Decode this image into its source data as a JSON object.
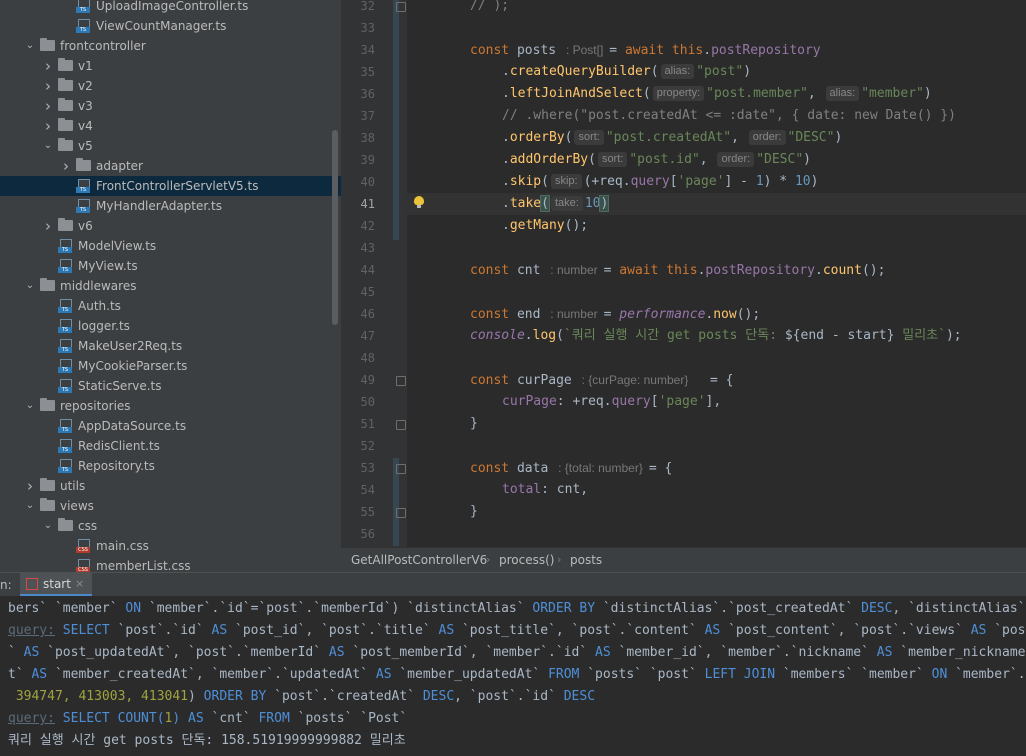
{
  "project_tree": {
    "items": [
      {
        "label": "UploadImageController.ts",
        "type": "ts",
        "indent": 5,
        "arrow": "",
        "selected": false
      },
      {
        "label": "ViewCountManager.ts",
        "type": "ts",
        "indent": 5,
        "arrow": "",
        "selected": false
      },
      {
        "label": "frontcontroller",
        "type": "folder",
        "indent": 3,
        "arrow": "open",
        "selected": false
      },
      {
        "label": "v1",
        "type": "folder",
        "indent": 4,
        "arrow": "closed",
        "selected": false
      },
      {
        "label": "v2",
        "type": "folder",
        "indent": 4,
        "arrow": "closed",
        "selected": false
      },
      {
        "label": "v3",
        "type": "folder",
        "indent": 4,
        "arrow": "closed",
        "selected": false
      },
      {
        "label": "v4",
        "type": "folder",
        "indent": 4,
        "arrow": "closed",
        "selected": false
      },
      {
        "label": "v5",
        "type": "folder",
        "indent": 4,
        "arrow": "open",
        "selected": false
      },
      {
        "label": "adapter",
        "type": "folder",
        "indent": 5,
        "arrow": "closed",
        "selected": false
      },
      {
        "label": "FrontControllerServletV5.ts",
        "type": "ts",
        "indent": 5,
        "arrow": "",
        "selected": true
      },
      {
        "label": "MyHandlerAdapter.ts",
        "type": "ts",
        "indent": 5,
        "arrow": "",
        "selected": false
      },
      {
        "label": "v6",
        "type": "folder",
        "indent": 4,
        "arrow": "closed",
        "selected": false
      },
      {
        "label": "ModelView.ts",
        "type": "ts",
        "indent": 4,
        "arrow": "",
        "selected": false
      },
      {
        "label": "MyView.ts",
        "type": "ts",
        "indent": 4,
        "arrow": "",
        "selected": false
      },
      {
        "label": "middlewares",
        "type": "folder",
        "indent": 3,
        "arrow": "open",
        "selected": false
      },
      {
        "label": "Auth.ts",
        "type": "ts",
        "indent": 4,
        "arrow": "",
        "selected": false
      },
      {
        "label": "logger.ts",
        "type": "ts",
        "indent": 4,
        "arrow": "",
        "selected": false
      },
      {
        "label": "MakeUser2Req.ts",
        "type": "ts",
        "indent": 4,
        "arrow": "",
        "selected": false
      },
      {
        "label": "MyCookieParser.ts",
        "type": "ts",
        "indent": 4,
        "arrow": "",
        "selected": false
      },
      {
        "label": "StaticServe.ts",
        "type": "ts",
        "indent": 4,
        "arrow": "",
        "selected": false
      },
      {
        "label": "repositories",
        "type": "folder",
        "indent": 3,
        "arrow": "open",
        "selected": false
      },
      {
        "label": "AppDataSource.ts",
        "type": "ts",
        "indent": 4,
        "arrow": "",
        "selected": false
      },
      {
        "label": "RedisClient.ts",
        "type": "ts",
        "indent": 4,
        "arrow": "",
        "selected": false
      },
      {
        "label": "Repository.ts",
        "type": "ts",
        "indent": 4,
        "arrow": "",
        "selected": false
      },
      {
        "label": "utils",
        "type": "folder",
        "indent": 3,
        "arrow": "closed",
        "selected": false
      },
      {
        "label": "views",
        "type": "folder",
        "indent": 3,
        "arrow": "open",
        "selected": false
      },
      {
        "label": "css",
        "type": "folder",
        "indent": 4,
        "arrow": "open",
        "selected": false
      },
      {
        "label": "main.css",
        "type": "css",
        "indent": 5,
        "arrow": "",
        "selected": false
      },
      {
        "label": "memberList.css",
        "type": "css",
        "indent": 5,
        "arrow": "",
        "selected": false
      }
    ]
  },
  "editor": {
    "line_numbers": [
      "32",
      "33",
      "34",
      "35",
      "36",
      "37",
      "38",
      "39",
      "40",
      "41",
      "42",
      "43",
      "44",
      "45",
      "46",
      "47",
      "48",
      "49",
      "50",
      "51",
      "52",
      "53",
      "54",
      "55",
      "56"
    ],
    "current_line": "41",
    "lines": [
      {
        "indent": 0,
        "tokens": [
          {
            "c": "cmt",
            "t": "// );"
          }
        ]
      },
      {
        "indent": 0,
        "tokens": []
      },
      {
        "indent": 0,
        "tokens": [
          {
            "c": "kw",
            "t": "const "
          },
          {
            "c": "",
            "t": "posts "
          },
          {
            "c": "hint2",
            "t": ": Post[]"
          },
          {
            "c": "",
            "t": "= "
          },
          {
            "c": "kw",
            "t": "await this"
          },
          {
            "c": "",
            "t": "."
          },
          {
            "c": "prop",
            "t": "postRepository"
          }
        ]
      },
      {
        "indent": 1,
        "tokens": [
          {
            "c": "",
            "t": "."
          },
          {
            "c": "fn",
            "t": "createQueryBuilder"
          },
          {
            "c": "",
            "t": "("
          },
          {
            "c": "hint",
            "t": "alias:"
          },
          {
            "c": "str",
            "t": "\"post\""
          },
          {
            "c": "",
            "t": ")"
          }
        ]
      },
      {
        "indent": 1,
        "tokens": [
          {
            "c": "",
            "t": "."
          },
          {
            "c": "fn",
            "t": "leftJoinAndSelect"
          },
          {
            "c": "",
            "t": "("
          },
          {
            "c": "hint",
            "t": "property:"
          },
          {
            "c": "str",
            "t": "\"post.member\""
          },
          {
            "c": "",
            "t": ", "
          },
          {
            "c": "hint",
            "t": "alias:"
          },
          {
            "c": "str",
            "t": "\"member\""
          },
          {
            "c": "",
            "t": ")"
          }
        ]
      },
      {
        "indent": 1,
        "tokens": [
          {
            "c": "cmt",
            "t": "// .where(\"post.createdAt <= :date\", { date: new Date() })"
          }
        ]
      },
      {
        "indent": 1,
        "tokens": [
          {
            "c": "",
            "t": "."
          },
          {
            "c": "fn",
            "t": "orderBy"
          },
          {
            "c": "",
            "t": "("
          },
          {
            "c": "hint",
            "t": "sort:"
          },
          {
            "c": "str",
            "t": "\"post.createdAt\""
          },
          {
            "c": "",
            "t": ", "
          },
          {
            "c": "hint",
            "t": "order:"
          },
          {
            "c": "str",
            "t": "\"DESC\""
          },
          {
            "c": "",
            "t": ")"
          }
        ]
      },
      {
        "indent": 1,
        "tokens": [
          {
            "c": "",
            "t": "."
          },
          {
            "c": "fn",
            "t": "addOrderBy"
          },
          {
            "c": "",
            "t": "("
          },
          {
            "c": "hint",
            "t": "sort:"
          },
          {
            "c": "str",
            "t": "\"post.id\""
          },
          {
            "c": "",
            "t": ", "
          },
          {
            "c": "hint",
            "t": "order:"
          },
          {
            "c": "str",
            "t": "\"DESC\""
          },
          {
            "c": "",
            "t": ")"
          }
        ]
      },
      {
        "indent": 1,
        "tokens": [
          {
            "c": "",
            "t": "."
          },
          {
            "c": "fn",
            "t": "skip"
          },
          {
            "c": "",
            "t": "("
          },
          {
            "c": "hint",
            "t": "skip:"
          },
          {
            "c": "",
            "t": "(+req."
          },
          {
            "c": "prop",
            "t": "query"
          },
          {
            "c": "",
            "t": "["
          },
          {
            "c": "str",
            "t": "'page'"
          },
          {
            "c": "",
            "t": "] - "
          },
          {
            "c": "num",
            "t": "1"
          },
          {
            "c": "",
            "t": ") * "
          },
          {
            "c": "num",
            "t": "10"
          },
          {
            "c": "",
            "t": ")"
          }
        ]
      },
      {
        "indent": 1,
        "tokens": [
          {
            "c": "",
            "t": "."
          },
          {
            "c": "fn",
            "t": "take"
          },
          {
            "c": "brk",
            "t": "("
          },
          {
            "c": "hint",
            "t": "take:"
          },
          {
            "c": "num",
            "t": "10"
          },
          {
            "c": "brk",
            "t": ")"
          }
        ]
      },
      {
        "indent": 1,
        "tokens": [
          {
            "c": "",
            "t": "."
          },
          {
            "c": "fn",
            "t": "getMany"
          },
          {
            "c": "",
            "t": "();"
          }
        ]
      },
      {
        "indent": 0,
        "tokens": []
      },
      {
        "indent": 0,
        "tokens": [
          {
            "c": "kw",
            "t": "const "
          },
          {
            "c": "",
            "t": "cnt "
          },
          {
            "c": "hint2",
            "t": ": number"
          },
          {
            "c": "",
            "t": "= "
          },
          {
            "c": "kw",
            "t": "await this"
          },
          {
            "c": "",
            "t": "."
          },
          {
            "c": "prop",
            "t": "postRepository"
          },
          {
            "c": "",
            "t": "."
          },
          {
            "c": "fn",
            "t": "count"
          },
          {
            "c": "",
            "t": "();"
          }
        ]
      },
      {
        "indent": 0,
        "tokens": []
      },
      {
        "indent": 0,
        "tokens": [
          {
            "c": "kw",
            "t": "const "
          },
          {
            "c": "",
            "t": "end "
          },
          {
            "c": "hint2",
            "t": ": number"
          },
          {
            "c": "",
            "t": "= "
          },
          {
            "c": "prop it",
            "t": "performance"
          },
          {
            "c": "",
            "t": "."
          },
          {
            "c": "fn",
            "t": "now"
          },
          {
            "c": "",
            "t": "();"
          }
        ]
      },
      {
        "indent": 0,
        "tokens": [
          {
            "c": "prop it",
            "t": "console"
          },
          {
            "c": "",
            "t": "."
          },
          {
            "c": "fn",
            "t": "log"
          },
          {
            "c": "",
            "t": "("
          },
          {
            "c": "str",
            "t": "`쿼리 실행 시간 get posts 단독: "
          },
          {
            "c": "",
            "t": "${end - start}"
          },
          {
            "c": "str",
            "t": " 밀리초`"
          },
          {
            "c": "",
            "t": ");"
          }
        ]
      },
      {
        "indent": 0,
        "tokens": []
      },
      {
        "indent": 0,
        "tokens": [
          {
            "c": "kw",
            "t": "const "
          },
          {
            "c": "",
            "t": "curPage "
          },
          {
            "c": "hint2",
            "t": ": {curPage: number}"
          },
          {
            "c": "",
            "t": "  = {"
          }
        ]
      },
      {
        "indent": 1,
        "tokens": [
          {
            "c": "prop",
            "t": "curPage"
          },
          {
            "c": "",
            "t": ": +req."
          },
          {
            "c": "prop",
            "t": "query"
          },
          {
            "c": "",
            "t": "["
          },
          {
            "c": "str",
            "t": "'page'"
          },
          {
            "c": "",
            "t": "],"
          }
        ]
      },
      {
        "indent": 0,
        "tokens": [
          {
            "c": "",
            "t": "}"
          }
        ]
      },
      {
        "indent": 0,
        "tokens": []
      },
      {
        "indent": 0,
        "tokens": [
          {
            "c": "kw",
            "t": "const "
          },
          {
            "c": "",
            "t": "data "
          },
          {
            "c": "hint2",
            "t": ": {total: number}"
          },
          {
            "c": "",
            "t": "= {"
          }
        ]
      },
      {
        "indent": 1,
        "tokens": [
          {
            "c": "prop",
            "t": "total"
          },
          {
            "c": "",
            "t": ": cnt,"
          }
        ]
      },
      {
        "indent": 0,
        "tokens": [
          {
            "c": "",
            "t": "}"
          }
        ]
      },
      {
        "indent": 0,
        "tokens": []
      }
    ]
  },
  "breadcrumbs": [
    "GetAllPostControllerV6",
    "process()",
    "posts"
  ],
  "run_panel": {
    "prefix": "n:",
    "tab_label": "start",
    "close_glyph": "×",
    "output": [
      [
        {
          "c": "sqlc",
          "t": "bers` `member` "
        },
        {
          "c": "sql",
          "t": "ON"
        },
        {
          "c": "sqlc",
          "t": " `member`.`id`=`post`.`memberId`) `distinctAlias` "
        },
        {
          "c": "sql",
          "t": "ORDER BY"
        },
        {
          "c": "sqlc",
          "t": " `distinctAlias`.`post_createdAt` "
        },
        {
          "c": "sql",
          "t": "DESC"
        },
        {
          "c": "sqlc",
          "t": ", `distinctAlias`.`post_id` DESC"
        }
      ],
      [
        {
          "c": "q",
          "t": "query:"
        },
        {
          "c": "sql",
          "t": " SELECT"
        },
        {
          "c": "sqlc",
          "t": " `post`.`id` "
        },
        {
          "c": "sql",
          "t": "AS"
        },
        {
          "c": "sqlc",
          "t": " `post_id`, `post`.`title` "
        },
        {
          "c": "sql",
          "t": "AS"
        },
        {
          "c": "sqlc",
          "t": " `post_title`, `post`.`content` "
        },
        {
          "c": "sql",
          "t": "AS"
        },
        {
          "c": "sqlc",
          "t": " `post_content`, `post`.`views` "
        },
        {
          "c": "sql",
          "t": "AS"
        },
        {
          "c": "sqlc",
          "t": " `post_views`,"
        }
      ],
      [
        {
          "c": "sqlc",
          "t": "` "
        },
        {
          "c": "sql",
          "t": "AS"
        },
        {
          "c": "sqlc",
          "t": " `post_updatedAt`, `post`.`memberId` "
        },
        {
          "c": "sql",
          "t": "AS"
        },
        {
          "c": "sqlc",
          "t": " `post_memberId`, `member`.`id` "
        },
        {
          "c": "sql",
          "t": "AS"
        },
        {
          "c": "sqlc",
          "t": " `member_id`, `member`.`nickname` "
        },
        {
          "c": "sql",
          "t": "AS"
        },
        {
          "c": "sqlc",
          "t": " `member_nickname`"
        }
      ],
      [
        {
          "c": "sqlc",
          "t": "t` "
        },
        {
          "c": "sql",
          "t": "AS"
        },
        {
          "c": "sqlc",
          "t": " `member_createdAt`, `member`.`updatedAt` "
        },
        {
          "c": "sql",
          "t": "AS"
        },
        {
          "c": "sqlc",
          "t": " `member_updatedAt` "
        },
        {
          "c": "sql",
          "t": "FROM"
        },
        {
          "c": "sqlc",
          "t": " `posts` `post` "
        },
        {
          "c": "sql",
          "t": "LEFT JOIN"
        },
        {
          "c": "sqlc",
          "t": " `members` `member` "
        },
        {
          "c": "sql",
          "t": "ON"
        },
        {
          "c": "sqlc",
          "t": " `member`.`id`"
        }
      ],
      [
        {
          "c": "sqln",
          "t": " 394747, 413003, 413041"
        },
        {
          "c": "sqlc",
          "t": ") "
        },
        {
          "c": "sql",
          "t": "ORDER BY"
        },
        {
          "c": "sqlc",
          "t": " `post`.`createdAt` "
        },
        {
          "c": "sql",
          "t": "DESC"
        },
        {
          "c": "sqlc",
          "t": ", `post`.`id` "
        },
        {
          "c": "sql",
          "t": "DESC"
        }
      ],
      [
        {
          "c": "q",
          "t": "query:"
        },
        {
          "c": "sql",
          "t": " SELECT COUNT("
        },
        {
          "c": "sqln",
          "t": "1"
        },
        {
          "c": "sql",
          "t": ") AS"
        },
        {
          "c": "sqlc",
          "t": " `cnt` "
        },
        {
          "c": "sql",
          "t": "FROM"
        },
        {
          "c": "sqlc",
          "t": " `posts` `Post`"
        }
      ],
      [
        {
          "c": "sqlc",
          "t": "쿼리 실행 시간 get posts 단독: 158.51919999999882 밀리초"
        }
      ]
    ]
  }
}
